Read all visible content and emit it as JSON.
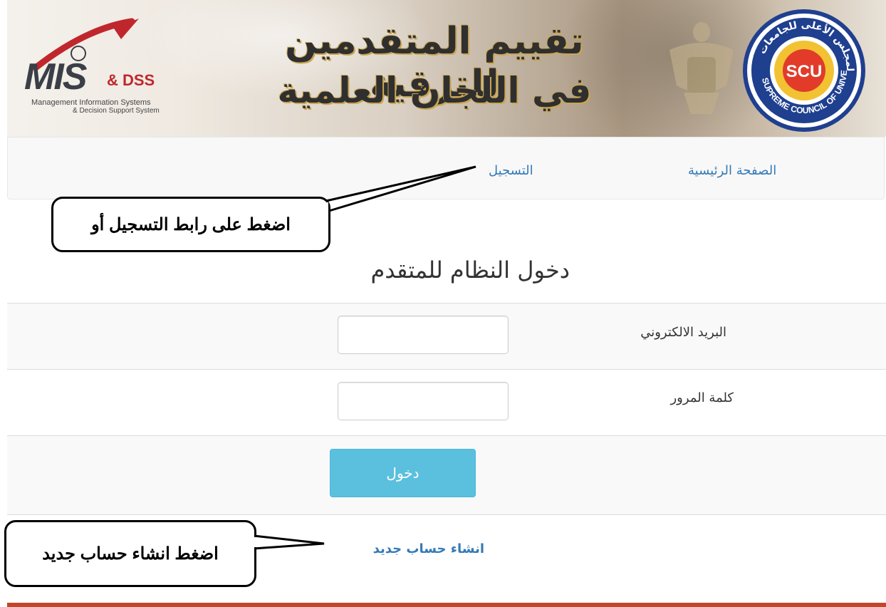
{
  "banner": {
    "title_line1": "تقييم المتقدمين للترقية",
    "title_line2": "في اللجان العلمية",
    "logo": {
      "mis": "MIS",
      "dss": "& DSS",
      "subtitle1": "Management Information Systems",
      "subtitle2": "& Decision Support System"
    },
    "seal": {
      "center": "SCU",
      "ring_en": "SUPREME COUNCIL OF UNIVERSITIES",
      "ring_ar": "المجلس الأعلى للجامعات"
    }
  },
  "nav": {
    "home": "الصفحة الرئيسية",
    "register": "التسجيل"
  },
  "form": {
    "title": "دخول النظام للمتقدم",
    "email_label": "البريد الالكتروني",
    "email_value": "",
    "password_label": "كلمة المرور",
    "password_value": "",
    "login_button": "دخول",
    "signup_link": "انشاء حساب جديد"
  },
  "callouts": {
    "register_hint": "اضغط على رابط التسجيل أو",
    "signup_hint": "اضغط انشاء حساب جديد"
  },
  "colors": {
    "link": "#337ab7",
    "button": "#5bc0de",
    "navbar_bg": "#f8f8f8",
    "bottom_bar": "#c2462a",
    "title_shadow": "#caa654"
  }
}
